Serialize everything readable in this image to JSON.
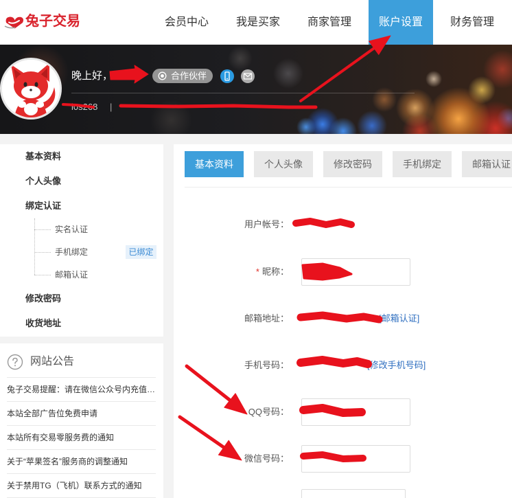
{
  "logo": {
    "text": "兔子交易",
    "icon": "rabbit-handshake-icon"
  },
  "nav": [
    {
      "label": "会员中心",
      "active": false
    },
    {
      "label": "我是买家",
      "active": false
    },
    {
      "label": "商家管理",
      "active": false
    },
    {
      "label": "账户设置",
      "active": true
    },
    {
      "label": "财务管理",
      "active": false
    }
  ],
  "profile": {
    "greeting": "晚上好，",
    "badge": "合作伙伴",
    "badge_icon": "partner-icon",
    "phone_icon": "phone-icon",
    "email_icon": "mail-icon",
    "user_id": "l0s268",
    "separator": "|"
  },
  "sidebar": {
    "items": [
      {
        "label": "基本资料"
      },
      {
        "label": "个人头像"
      },
      {
        "label": "绑定认证",
        "children": [
          {
            "label": "实名认证"
          },
          {
            "label": "手机绑定",
            "badge": "已绑定"
          },
          {
            "label": "邮箱认证"
          }
        ]
      },
      {
        "label": "修改密码"
      },
      {
        "label": "收货地址"
      }
    ]
  },
  "announcements": {
    "icon": "question-circle-icon",
    "title": "网站公告",
    "items": [
      "兔子交易提醒：请在微信公众号内充值…",
      "本站全部广告位免费申请",
      "本站所有交易零服务费的通知",
      "关于“苹果签名”服务商的调整通知",
      "关于禁用TG（飞机）联系方式的通知"
    ]
  },
  "tabs": [
    {
      "label": "基本资料",
      "active": true
    },
    {
      "label": "个人头像",
      "active": false
    },
    {
      "label": "修改密码",
      "active": false
    },
    {
      "label": "手机绑定",
      "active": false
    },
    {
      "label": "邮箱认证",
      "active": false
    }
  ],
  "form": {
    "required_mark": "*",
    "rows": [
      {
        "label": "用户帐号："
      },
      {
        "label": "昵称：",
        "required": true
      },
      {
        "label": "邮箱地址：",
        "link": "[邮箱认证]"
      },
      {
        "label": "手机号码：",
        "link": "[修改手机号码]"
      },
      {
        "label": "QQ号码："
      },
      {
        "label": "微信号码："
      }
    ]
  },
  "colors": {
    "accent": "#3d9fdb",
    "brand": "#d9232d",
    "link": "#2f6fc0",
    "annotation": "#e8121d"
  }
}
